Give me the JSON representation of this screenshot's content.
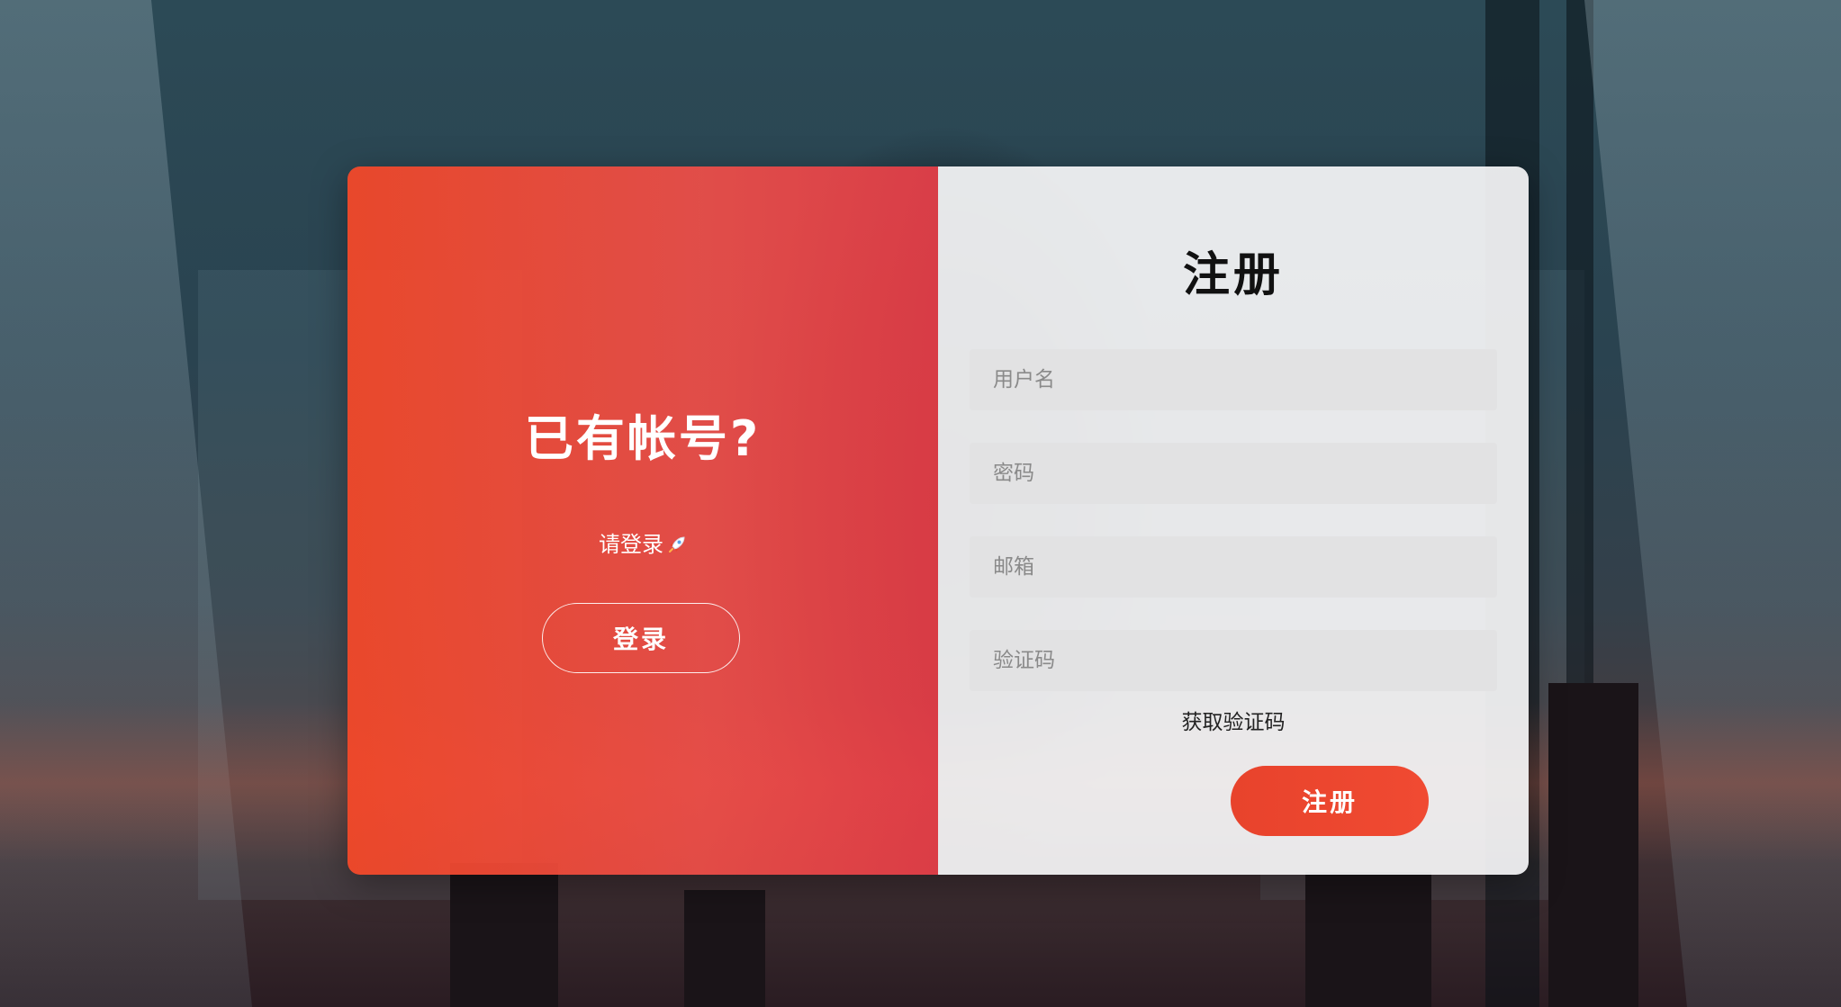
{
  "left_panel": {
    "title": "已有帐号?",
    "subtitle": "请登录",
    "subtitle_icon": "rocket-icon",
    "login_button_label": "登录"
  },
  "register_form": {
    "title": "注册",
    "username_placeholder": "用户名",
    "password_placeholder": "密码",
    "email_placeholder": "邮箱",
    "code_placeholder": "验证码",
    "get_code_label": "获取验证码",
    "submit_label": "注册"
  },
  "colors": {
    "accent": "#f04a32",
    "left_panel": "#f04e48",
    "right_panel": "#f5f5f6",
    "input_background": "#e2e2e3"
  }
}
